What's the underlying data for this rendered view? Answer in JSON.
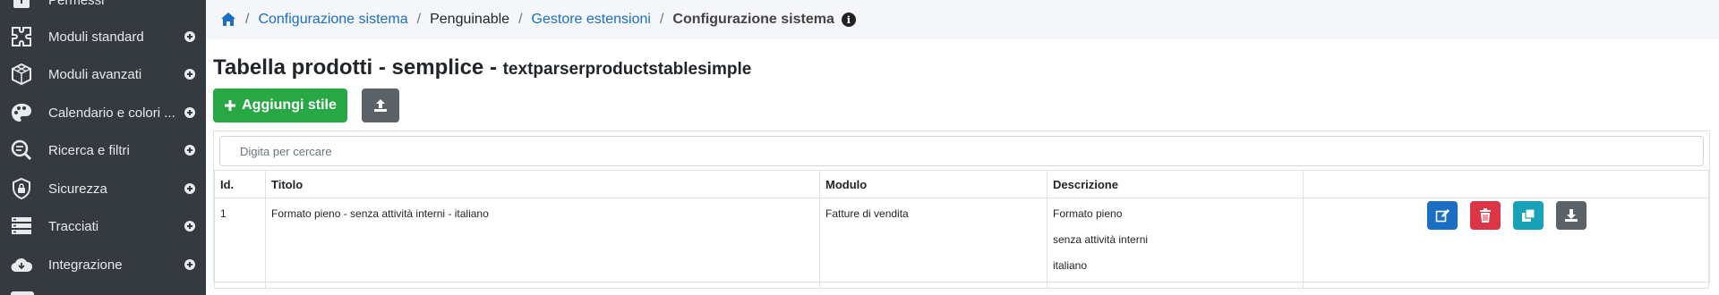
{
  "sidebar": {
    "items": [
      {
        "label": "Permessi",
        "icon": "key-icon"
      },
      {
        "label": "Moduli standard",
        "icon": "puzzle-icon"
      },
      {
        "label": "Moduli avanzati",
        "icon": "cubes-icon"
      },
      {
        "label": "Calendario e colori ...",
        "icon": "palette-icon"
      },
      {
        "label": "Ricerca e filtri",
        "icon": "search-filter-icon"
      },
      {
        "label": "Sicurezza",
        "icon": "shield-icon"
      },
      {
        "label": "Tracciati",
        "icon": "server-icon"
      },
      {
        "label": "Integrazione",
        "icon": "cloud-icon"
      }
    ]
  },
  "breadcrumb": {
    "items": [
      "Configurazione sistema",
      "Penguinable",
      "Gestore estensioni"
    ],
    "active": "Configurazione sistema"
  },
  "page": {
    "title": "Tabella prodotti - semplice -",
    "subtitle": "textparserproductstablesimple"
  },
  "toolbar": {
    "add_label": "Aggiungi stile"
  },
  "search": {
    "placeholder": "Digita per cercare"
  },
  "table": {
    "headers": [
      "Id.",
      "Titolo",
      "Modulo",
      "Descrizione",
      ""
    ],
    "rows": [
      {
        "id": "1",
        "title": "Formato pieno - senza attività interni - italiano",
        "module": "Fatture di vendita",
        "description": [
          "Formato pieno",
          "senza attività interni",
          "italiano"
        ]
      }
    ]
  },
  "colors": {
    "sidebar": "#343a40",
    "success": "#28a745",
    "primary": "#1a6fc4",
    "danger": "#dc3545",
    "info": "#17a2b8",
    "secondary": "#5a6268"
  }
}
